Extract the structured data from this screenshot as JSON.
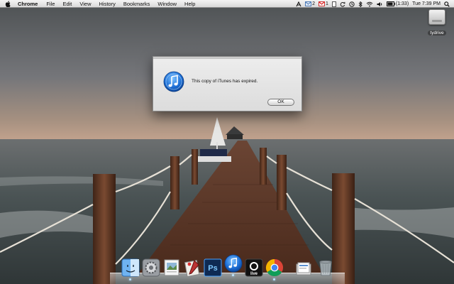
{
  "menubar": {
    "app_name": "Chrome",
    "items": [
      "File",
      "Edit",
      "View",
      "History",
      "Bookmarks",
      "Window",
      "Help"
    ],
    "status": {
      "mail_count": "2",
      "gmail_count": "1",
      "battery": "(1:33)",
      "clock": "Tue 7:39 PM"
    }
  },
  "desktop": {
    "drive_label": "tydrive"
  },
  "dialog": {
    "message": "This copy of iTunes has expired.",
    "ok_label": "OK"
  },
  "dock": {
    "items": [
      {
        "name": "finder",
        "icon": "finder-icon"
      },
      {
        "name": "system-preferences",
        "icon": "gear-icon"
      },
      {
        "name": "preview",
        "icon": "preview-icon"
      },
      {
        "name": "script-editor",
        "icon": "script-icon"
      },
      {
        "name": "photoshop",
        "icon": "photoshop-icon",
        "text": "Ps"
      },
      {
        "name": "itunes",
        "icon": "itunes-icon"
      },
      {
        "name": "ableton-live",
        "icon": "live-icon",
        "text": "live"
      },
      {
        "name": "chrome",
        "icon": "chrome-icon"
      },
      {
        "name": "documents",
        "icon": "documents-icon"
      },
      {
        "name": "trash",
        "icon": "trash-icon"
      }
    ]
  },
  "colors": {
    "sky_top": "#55585a",
    "sky_horizon": "#b49b8c",
    "sea": "#4d5657",
    "pier_wood": "#5a3524",
    "dialog_bg": "#e6e6e6",
    "itunes_blue": "#1a6fd1"
  }
}
